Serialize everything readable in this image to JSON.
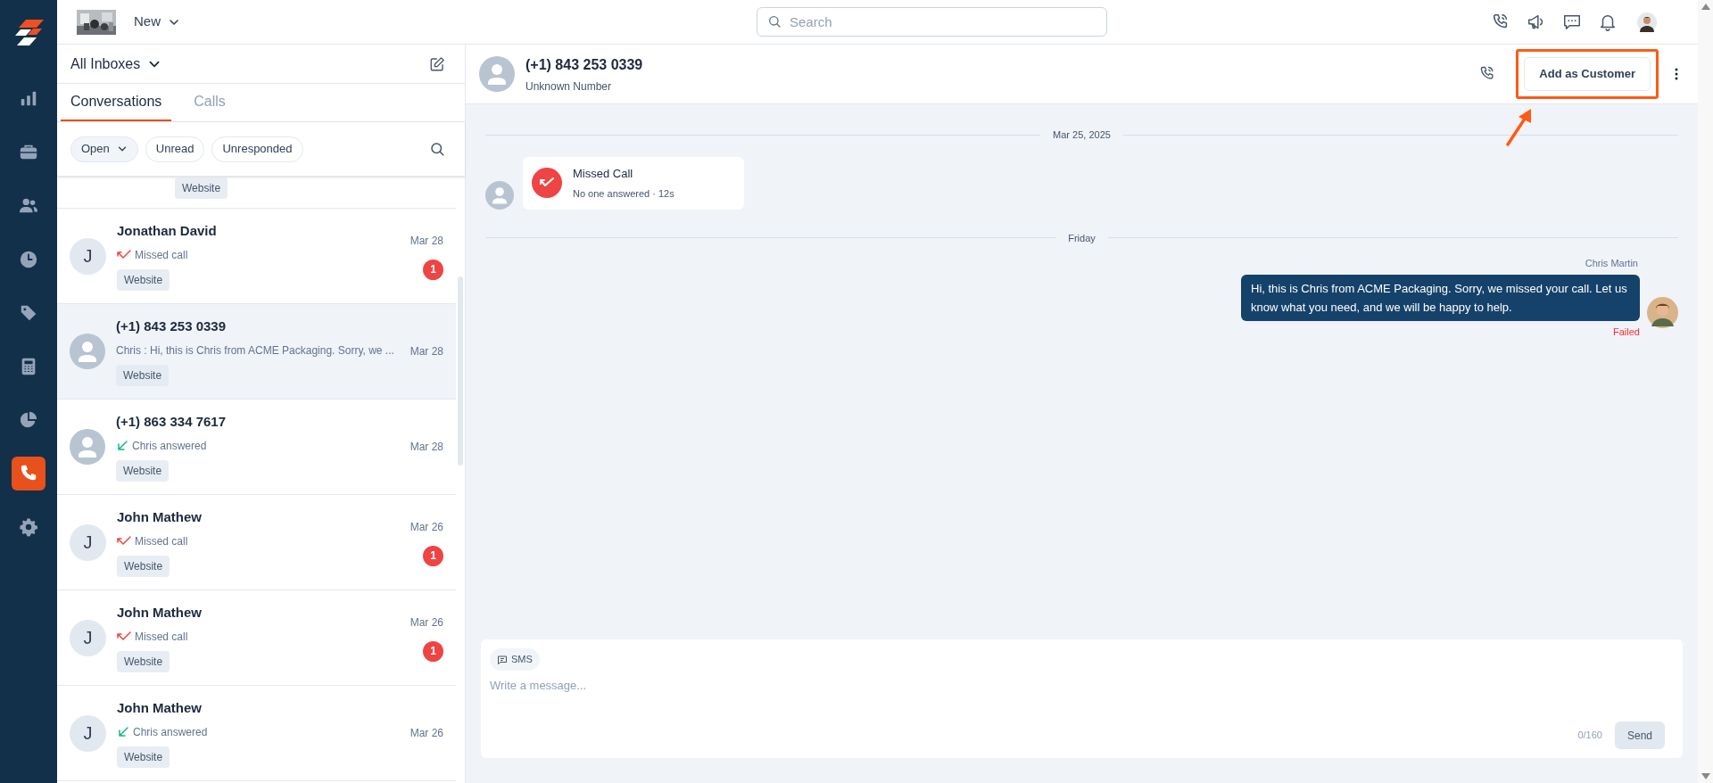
{
  "nav": {
    "items": [
      {
        "kind": "chart",
        "selected": false
      },
      {
        "kind": "briefcase",
        "selected": false
      },
      {
        "kind": "users",
        "selected": false
      },
      {
        "kind": "clock",
        "selected": false
      },
      {
        "kind": "tag",
        "selected": false
      },
      {
        "kind": "calculator",
        "selected": false
      },
      {
        "kind": "pie",
        "selected": false
      },
      {
        "kind": "phone",
        "selected": true
      },
      {
        "kind": "gear",
        "selected": false
      }
    ]
  },
  "topbar": {
    "workspace": "New",
    "search": {
      "placeholder": "Search"
    },
    "icons": [
      {
        "kind": "phone"
      },
      {
        "kind": "megaphone"
      },
      {
        "kind": "chat"
      },
      {
        "kind": "bell"
      }
    ]
  },
  "inbox": {
    "title": "All Inboxes"
  },
  "tabs": [
    {
      "label": "Conversations",
      "selected": true
    },
    {
      "label": "Calls",
      "selected": false
    }
  ],
  "filters": [
    {
      "label": "Open",
      "dropdown": true
    },
    {
      "label": "Unread",
      "dropdown": false
    },
    {
      "label": "Unresponded",
      "dropdown": false
    }
  ],
  "conversations": [
    {
      "partial": true,
      "tag": "Website"
    },
    {
      "avatar": "J",
      "name": "Jonathan David",
      "status": {
        "kind": "missed",
        "text": "Missed call"
      },
      "tag": "Website",
      "date": "Mar 28",
      "unread": "1",
      "selected": false
    },
    {
      "name": "(+1) 843 253 0339",
      "preview": "Chris : Hi, this is Chris from ACME Packaging. Sorry, we ...",
      "tag": "Website",
      "date": "Mar 28",
      "selected": true
    },
    {
      "name": "(+1) 863 334 7617",
      "status": {
        "kind": "answered",
        "text": "Chris answered"
      },
      "tag": "Website",
      "date": "Mar 28",
      "selected": false
    },
    {
      "avatar": "J",
      "name": "John Mathew",
      "status": {
        "kind": "missed",
        "text": "Missed call"
      },
      "tag": "Website",
      "date": "Mar 26",
      "unread": "1",
      "selected": false
    },
    {
      "avatar": "J",
      "name": "John Mathew",
      "status": {
        "kind": "missed",
        "text": "Missed call"
      },
      "tag": "Website",
      "date": "Mar 26",
      "unread": "1",
      "selected": false
    },
    {
      "avatar": "J",
      "name": "John Mathew",
      "status": {
        "kind": "answered",
        "text": "Chris answered"
      },
      "tag": "Website",
      "date": "Mar 26",
      "selected": false
    }
  ],
  "chat": {
    "title": "(+1) 843 253 0339",
    "subtitle": "Unknown Number",
    "action": "Add as Customer",
    "messages": [
      {
        "kind": "divider",
        "text": "Mar 25, 2025"
      },
      {
        "kind": "call",
        "title": "Missed Call",
        "detail": "No one answered · 12s"
      },
      {
        "kind": "divider",
        "text": "Friday"
      },
      {
        "kind": "outgoing",
        "sender": "Chris Martin",
        "text": "Hi, this is Chris from ACME Packaging. Sorry, we missed your call. Let us know what you need, and we will be happy to help.",
        "status": "Failed"
      }
    ]
  },
  "composer": {
    "channel": "SMS",
    "placeholder": "Write a message...",
    "counter": "0/160",
    "send": "Send"
  }
}
